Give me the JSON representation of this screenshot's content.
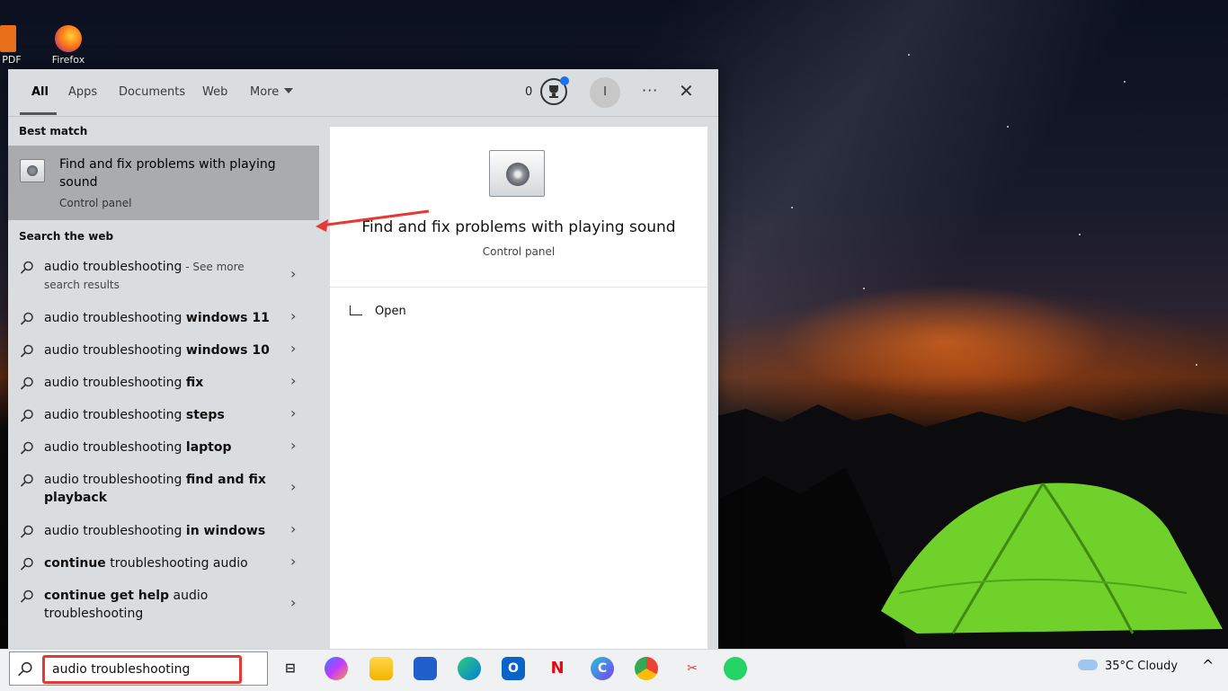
{
  "desktop": {
    "icons": [
      {
        "label": "PDF",
        "name": "pdf-desktop-icon"
      },
      {
        "label": "Firefox",
        "name": "firefox-desktop-icon"
      }
    ]
  },
  "search_panel": {
    "tabs": [
      {
        "label": "All",
        "active": true
      },
      {
        "label": "Apps"
      },
      {
        "label": "Documents"
      },
      {
        "label": "Web"
      },
      {
        "label": "More"
      }
    ],
    "rewards_points": "0",
    "profile_initial": "I",
    "more_options": "···",
    "close": "✕",
    "best_match": {
      "section": "Best match",
      "title": "Find and fix problems with playing sound",
      "subtitle": "Control panel"
    },
    "web_section": "Search the web",
    "web_results": [
      {
        "prefix": "audio troubleshooting",
        "bold": "",
        "suffix": " - See more search results"
      },
      {
        "prefix": "audio troubleshooting ",
        "bold": "windows 11"
      },
      {
        "prefix": "audio troubleshooting ",
        "bold": "windows 10"
      },
      {
        "prefix": "audio troubleshooting ",
        "bold": "fix"
      },
      {
        "prefix": "audio troubleshooting ",
        "bold": "steps"
      },
      {
        "prefix": "audio troubleshooting ",
        "bold": "laptop"
      },
      {
        "prefix": "audio troubleshooting ",
        "bold": "find and fix playback"
      },
      {
        "prefix": "audio troubleshooting ",
        "bold": "in windows"
      },
      {
        "bold_first": "continue",
        "rest": " troubleshooting audio"
      },
      {
        "bold_first": "continue get help",
        "rest": " audio troubleshooting"
      }
    ],
    "preview": {
      "title": "Find and fix problems with playing sound",
      "subtitle": "Control panel",
      "action_open": "Open"
    }
  },
  "taskbar": {
    "search_value": "audio troubleshooting",
    "apps": [
      "task-view",
      "copilot",
      "file-explorer",
      "microsoft-store",
      "edge",
      "outlook",
      "netflix",
      "canva",
      "chrome",
      "snipping-tool",
      "whatsapp"
    ],
    "weather": {
      "temp": "35°C",
      "condition": "Cloudy"
    },
    "tray_chevron": "^"
  },
  "colors": {
    "highlight": "#e53935",
    "panel_bg": "#d9dde0",
    "best_match_bg": "#a9abad"
  }
}
